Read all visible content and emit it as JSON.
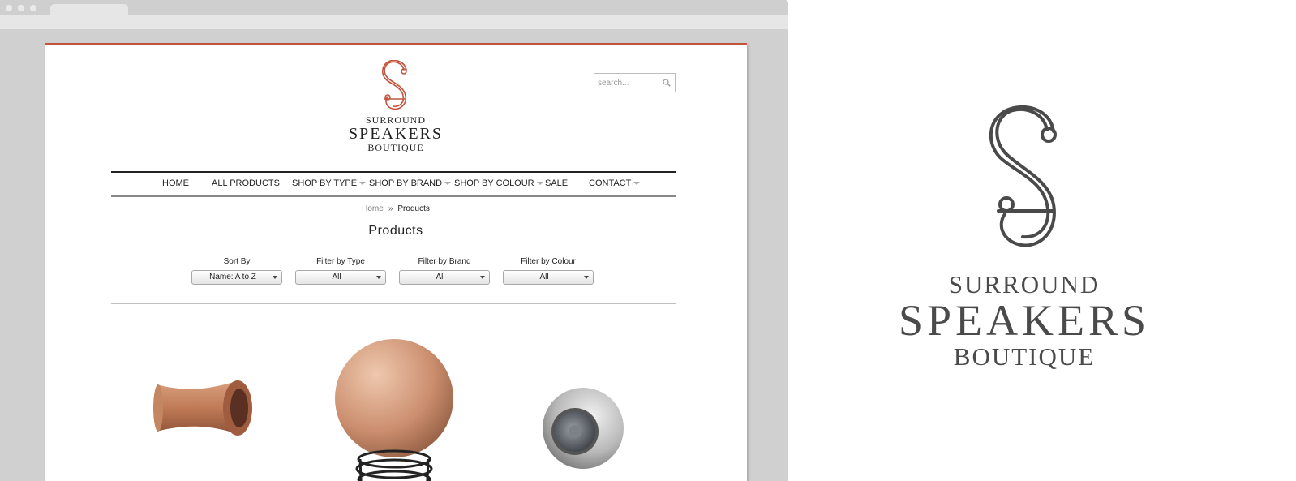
{
  "colors": {
    "accent": "#c4533b",
    "dark": "#222222",
    "logo_gray": "#4a4a4a"
  },
  "logo": {
    "icon": "s-monogram-icon",
    "line1": "SURROUND",
    "line2": "SPEAKERS",
    "line3": "BOUTIQUE"
  },
  "search": {
    "placeholder": "search..."
  },
  "nav": {
    "items": [
      {
        "label": "HOME",
        "dropdown": false
      },
      {
        "label": "ALL PRODUCTS",
        "dropdown": false
      },
      {
        "label": "SHOP BY TYPE",
        "dropdown": true
      },
      {
        "label": "SHOP BY BRAND",
        "dropdown": true
      },
      {
        "label": "SHOP BY COLOUR",
        "dropdown": true
      },
      {
        "label": "SALE",
        "dropdown": false
      },
      {
        "label": "CONTACT",
        "dropdown": true
      }
    ]
  },
  "breadcrumb": {
    "home": "Home",
    "separator": "»",
    "current": "Products"
  },
  "page_title": "Products",
  "filters": [
    {
      "label": "Sort By",
      "value": "Name: A to Z"
    },
    {
      "label": "Filter by Type",
      "value": "All"
    },
    {
      "label": "Filter by Brand",
      "value": "All"
    },
    {
      "label": "Filter by Colour",
      "value": "All"
    }
  ],
  "products": [
    {
      "image": "terracotta-horn-speaker-image"
    },
    {
      "image": "terracotta-sphere-speaker-image"
    },
    {
      "image": "silver-sphere-speaker-image"
    }
  ]
}
